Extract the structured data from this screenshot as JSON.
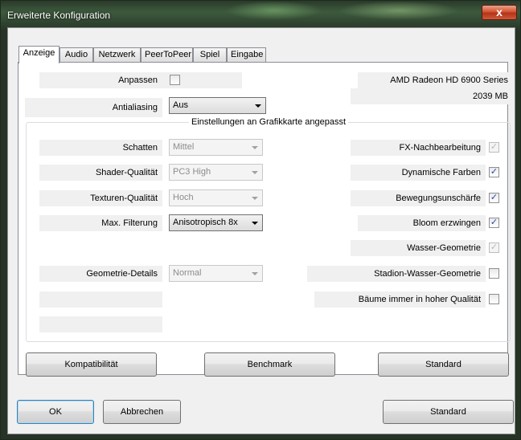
{
  "window": {
    "title": "Erweiterte Konfiguration",
    "close_label": "x"
  },
  "tabs": [
    {
      "label": "Anzeige"
    },
    {
      "label": "Audio"
    },
    {
      "label": "Netzwerk"
    },
    {
      "label": "PeerToPeer"
    },
    {
      "label": "Spiel"
    },
    {
      "label": "Eingabe"
    }
  ],
  "top": {
    "anpassen_label": "Anpassen",
    "anpassen_checked": false,
    "antialiasing_label": "Antialiasing",
    "antialiasing_value": "Aus",
    "gpu_name": "AMD Radeon HD 6900 Series",
    "gpu_memory": "2039 MB"
  },
  "group": {
    "title": "Einstellungen an Grafikkarte angepasst",
    "left": [
      {
        "label": "Schatten",
        "value": "Mittel",
        "enabled": false
      },
      {
        "label": "Shader-Qualität",
        "value": "PC3 High",
        "enabled": false
      },
      {
        "label": "Texturen-Qualität",
        "value": "Hoch",
        "enabled": false
      },
      {
        "label": "Max. Filterung",
        "value": "Anisotropisch 8x",
        "enabled": true
      },
      {
        "label": "Geometrie-Details",
        "value": "Normal",
        "enabled": false
      }
    ],
    "right": [
      {
        "label": "FX-Nachbearbeitung",
        "checked": true,
        "enabled": false
      },
      {
        "label": "Dynamische Farben",
        "checked": true,
        "enabled": true
      },
      {
        "label": "Bewegungsunschärfe",
        "checked": true,
        "enabled": true
      },
      {
        "label": "Bloom erzwingen",
        "checked": true,
        "enabled": true
      },
      {
        "label": "Wasser-Geometrie",
        "checked": true,
        "enabled": false
      },
      {
        "label": "Stadion-Wasser-Geometrie",
        "checked": false,
        "enabled": true
      },
      {
        "label": "Bäume immer in hoher Qualität",
        "checked": false,
        "enabled": true
      }
    ]
  },
  "panel_buttons": {
    "compat": "Kompatibilität",
    "benchmark": "Benchmark",
    "standard": "Standard"
  },
  "dialog_buttons": {
    "ok": "OK",
    "cancel": "Abbrechen",
    "standard": "Standard"
  },
  "check_glyph": "✓"
}
